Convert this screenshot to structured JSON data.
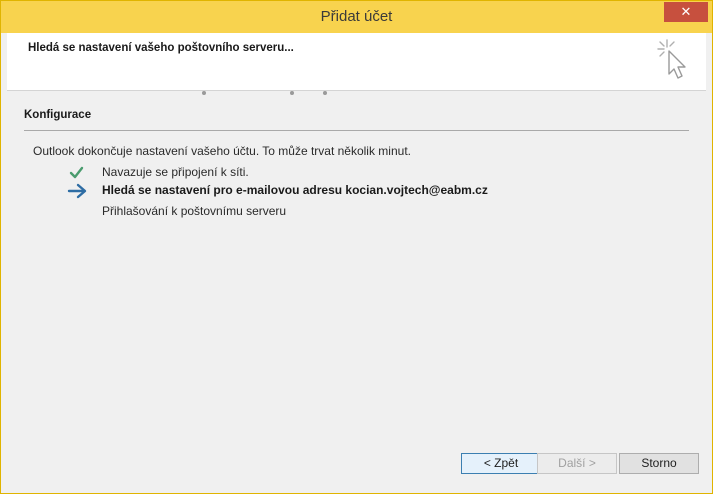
{
  "window": {
    "title": "Přidat účet",
    "close_label": "✕"
  },
  "header": {
    "title": "Hledá se nastavení vašeho poštovního serveru...",
    "icon": "cursor-sparkle-icon"
  },
  "section": {
    "title": "Konfigurace",
    "intro": "Outlook dokončuje nastavení vašeho účtu. To může trvat několik minut."
  },
  "steps": [
    {
      "label": "Navazuje se připojení k síti.",
      "status": "done",
      "icon": "checkmark-icon"
    },
    {
      "label": "Hledá se nastavení pro e-mailovou adresu kocian.vojtech@eabm.cz",
      "status": "in-progress",
      "icon": "arrow-right-icon"
    },
    {
      "label": "Přihlašování k poštovnímu serveru",
      "status": "pending",
      "icon": ""
    }
  ],
  "buttons": {
    "back": "< Zpět",
    "next": "Další >",
    "cancel": "Storno"
  },
  "colors": {
    "titlebar": "#f8d34e",
    "close": "#c7503e",
    "check": "#4a9c6e",
    "arrow": "#2e6da4"
  }
}
